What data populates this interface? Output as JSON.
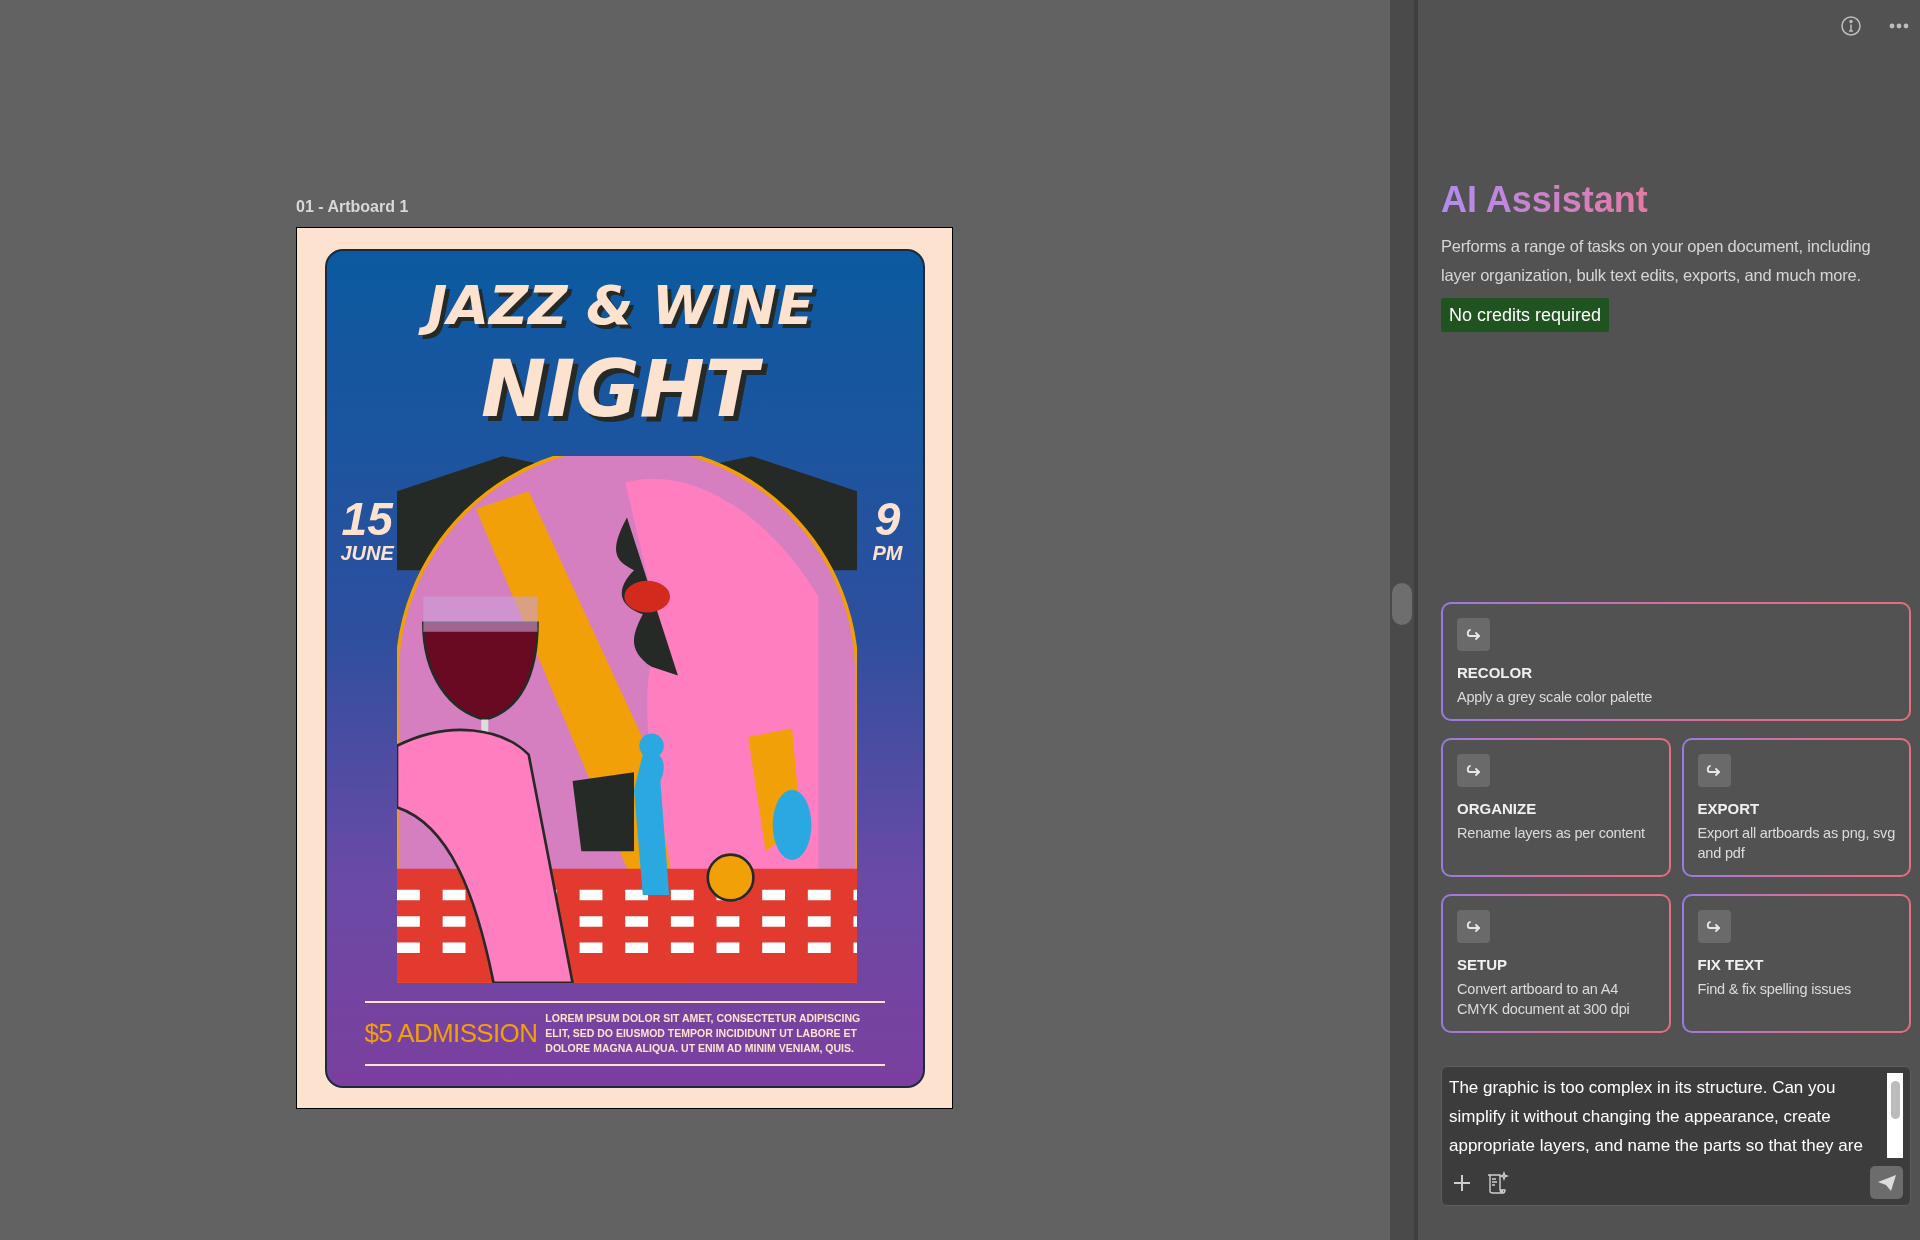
{
  "canvas": {
    "artboard_label": "01 - Artboard 1",
    "poster": {
      "title_lines": [
        "JAZZ & WINE",
        "NIGHT"
      ],
      "date": {
        "day": "15",
        "month": "JUNE"
      },
      "time": {
        "hour": "9",
        "period": "PM"
      },
      "admission": "$5 ADMISSION",
      "details": "LOREM IPSUM DOLOR SIT AMET, CONSECTETUR ADIPISCING ELIT, SED DO EIUSMOD TEMPOR INCIDIDUNT UT LABORE ET DOLORE MAGNA ALIQUA. UT ENIM AD MINIM VENIAM, QUIS."
    }
  },
  "assistant": {
    "title": "AI Assistant",
    "description": "Performs a range of tasks on your open document, including layer organization, bulk text edits, exports, and much more.",
    "badge": "No credits required",
    "suggestions": [
      {
        "title": "RECOLOR",
        "description": "Apply a grey scale color palette"
      },
      {
        "title": "ORGANIZE",
        "description": "Rename layers as per content"
      },
      {
        "title": "EXPORT",
        "description": "Export all artboards as png, svg and pdf"
      },
      {
        "title": "SETUP",
        "description": "Convert artboard to an A4 CMYK document at 300 dpi"
      },
      {
        "title": "FIX TEXT",
        "description": "Find & fix spelling issues"
      }
    ],
    "prompt": {
      "value": "The graphic is too complex in its structure. Can you simplify it without changing the appearance, create appropriate layers, and name the parts so that they are"
    }
  }
}
